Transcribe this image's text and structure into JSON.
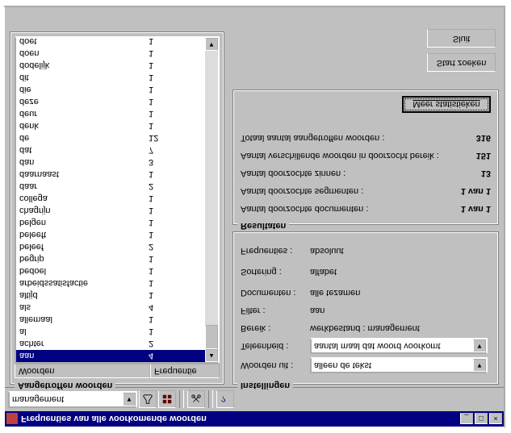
{
  "window": {
    "title": "Frequenties van alle voorkomende woorden"
  },
  "toolbar": {
    "combo_value": "management"
  },
  "left": {
    "group_title": "Aangetroffen woorden",
    "col_word": "Woorden",
    "col_freq": "Frequentie",
    "rows": [
      {
        "w": "aan",
        "f": "4",
        "sel": true
      },
      {
        "w": "achter",
        "f": "2"
      },
      {
        "w": "al",
        "f": "1"
      },
      {
        "w": "allemaal",
        "f": "1"
      },
      {
        "w": "als",
        "f": "4"
      },
      {
        "w": "altijd",
        "f": "1"
      },
      {
        "w": "arbeidssatisfactie",
        "f": "1"
      },
      {
        "w": "bedoel",
        "f": "1"
      },
      {
        "w": "begrip",
        "f": "1"
      },
      {
        "w": "beleef",
        "f": "2"
      },
      {
        "w": "beleeft",
        "f": "1"
      },
      {
        "w": "belgen",
        "f": "1"
      },
      {
        "w": "chagrijn",
        "f": "1"
      },
      {
        "w": "collega",
        "f": "1"
      },
      {
        "w": "daar",
        "f": "2"
      },
      {
        "w": "daarnaast",
        "f": "1"
      },
      {
        "w": "dan",
        "f": "3"
      },
      {
        "w": "dat",
        "f": "7"
      },
      {
        "w": "de",
        "f": "12"
      },
      {
        "w": "denk",
        "f": "1"
      },
      {
        "w": "deur",
        "f": "1"
      },
      {
        "w": "deze",
        "f": "1"
      },
      {
        "w": "die",
        "f": "1"
      },
      {
        "w": "dit",
        "f": "1"
      },
      {
        "w": "dodelijk",
        "f": "1"
      },
      {
        "w": "doen",
        "f": "1"
      },
      {
        "w": "doet",
        "f": "1"
      }
    ]
  },
  "settings": {
    "group_title": "Instellingen",
    "words_from_label": "Woorden uit :",
    "words_from_value": "alleen de tekst",
    "unit_label": "Teleenheid :",
    "unit_value": "aantal maal dat woord voorkomt",
    "range_label": "Bereik :",
    "range_value": "werkbestand : management",
    "filter_label": "Filter :",
    "filter_value": "aan",
    "docs_label": "Documenten :",
    "docs_value": "alle tezamen",
    "sort_label": "Sortering :",
    "sort_value": "alfabet",
    "freq_label": "Frequenties :",
    "freq_value": "absoluut"
  },
  "results": {
    "group_title": "Resultaten",
    "docs_label": "Aantal doorzochte documenten :",
    "docs_value": "1 van 1",
    "segs_label": "Aantal doorzochte segmenten :",
    "segs_value": "1 van 1",
    "sent_label": "Aantal doorzochte zinnen :",
    "sent_value": "13",
    "diff_label": "Aantal verschillende woorden in doorzocht bereik :",
    "diff_value": "151",
    "total_label": "Totaal aantal aangetroffen woorden :",
    "total_value": "316",
    "more_label": "Meer statistieken"
  },
  "buttons": {
    "start": "Start zoeken",
    "close": "Sluit"
  }
}
